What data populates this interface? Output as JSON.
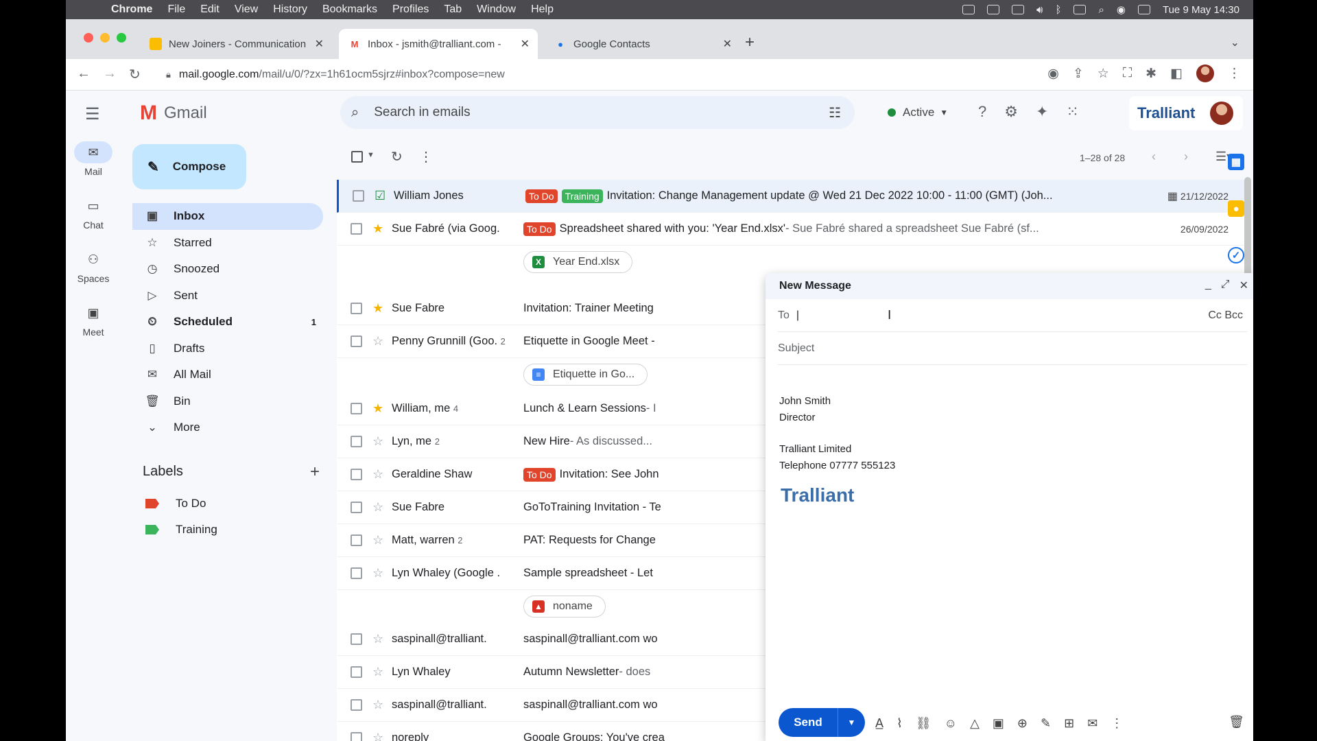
{
  "menubar": {
    "app": "Chrome",
    "items": [
      "File",
      "Edit",
      "View",
      "History",
      "Bookmarks",
      "Profiles",
      "Tab",
      "Window",
      "Help"
    ],
    "clock": "Tue 9 May  14:30"
  },
  "tabs": [
    {
      "title": "New Joiners - Communication",
      "icon": "calendar-icon"
    },
    {
      "title": "Inbox - jsmith@tralliant.com -",
      "icon": "gmail-icon"
    },
    {
      "title": "Google Contacts",
      "icon": "contacts-icon"
    }
  ],
  "url": {
    "host": "mail.google.com",
    "path": "/mail/u/0/?zx=1h61ocm5sjrz#inbox?compose=new"
  },
  "gmail": {
    "app_name": "Gmail",
    "search_placeholder": "Search in emails",
    "status": "Active",
    "brand": "Tralliant"
  },
  "rail": [
    {
      "label": "Mail",
      "icon": "mail-icon"
    },
    {
      "label": "Chat",
      "icon": "chat-icon"
    },
    {
      "label": "Spaces",
      "icon": "spaces-icon"
    },
    {
      "label": "Meet",
      "icon": "meet-icon"
    }
  ],
  "compose_button": "Compose",
  "nav": [
    {
      "label": "Inbox",
      "icon": "inbox-icon",
      "count": ""
    },
    {
      "label": "Starred",
      "icon": "star-icon",
      "count": ""
    },
    {
      "label": "Snoozed",
      "icon": "clock-icon",
      "count": ""
    },
    {
      "label": "Sent",
      "icon": "send-icon",
      "count": ""
    },
    {
      "label": "Scheduled",
      "icon": "scheduled-icon",
      "count": "1"
    },
    {
      "label": "Drafts",
      "icon": "draft-icon",
      "count": ""
    },
    {
      "label": "All Mail",
      "icon": "all-mail-icon",
      "count": ""
    },
    {
      "label": "Bin",
      "icon": "trash-icon",
      "count": ""
    },
    {
      "label": "More",
      "icon": "chevron-down-icon",
      "count": ""
    }
  ],
  "labels": {
    "heading": "Labels",
    "items": [
      {
        "label": "To Do",
        "color": "#e0452c"
      },
      {
        "label": "Training",
        "color": "#3cb45c"
      }
    ]
  },
  "list": {
    "count": "1–28 of 28",
    "rows": [
      {
        "sender": "William Jones",
        "n": "",
        "chips": [
          "To Do",
          "Training"
        ],
        "subject": "Invitation: Change Management update @ Wed 21 Dec 2022 10:00 - 11:00 (GMT) (Joh...",
        "snippet": "",
        "date": "21/12/2022",
        "starred": false
      },
      {
        "sender": "Sue Fabré (via Goog.",
        "n": "",
        "chips": [
          "To Do"
        ],
        "subject": "Spreadsheet shared with you: 'Year End.xlsx'",
        "snippet": " - Sue Fabré shared a spreadsheet Sue Fabré (sf...",
        "date": "26/09/2022",
        "starred": true,
        "attachment": "Year End.xlsx"
      },
      {
        "sender": "Sue Fabre",
        "n": "",
        "chips": [],
        "subject": "Invitation: Trainer Meeting",
        "snippet": "",
        "date": "",
        "starred": true
      },
      {
        "sender": "Penny Grunnill (Goo.",
        "n": "2",
        "chips": [],
        "subject": "Etiquette in Google Meet -",
        "snippet": "",
        "date": "",
        "starred": false,
        "attachment": "Etiquette in Go..."
      },
      {
        "sender": "William, me",
        "n": "4",
        "chips": [],
        "subject": "Lunch & Learn Sessions",
        "snippet": " - I",
        "date": "",
        "starred": true
      },
      {
        "sender": "Lyn, me",
        "n": "2",
        "chips": [],
        "subject": "New Hire",
        "snippet": " - As discussed...",
        "date": "",
        "starred": false
      },
      {
        "sender": "Geraldine Shaw",
        "n": "",
        "chips": [
          "To Do"
        ],
        "subject": "Invitation: See John",
        "snippet": "",
        "date": "",
        "starred": false
      },
      {
        "sender": "Sue Fabre",
        "n": "",
        "chips": [],
        "subject": "GoToTraining Invitation - Te",
        "snippet": "",
        "date": "",
        "starred": false
      },
      {
        "sender": "Matt, warren",
        "n": "2",
        "chips": [],
        "subject": "PAT: Requests for Change",
        "snippet": "",
        "date": "",
        "starred": false
      },
      {
        "sender": "Lyn Whaley (Google .",
        "n": "",
        "chips": [],
        "subject": "Sample spreadsheet - Let",
        "snippet": "",
        "date": "",
        "starred": false,
        "attachment": "noname"
      },
      {
        "sender": "saspinall@tralliant.",
        "n": "",
        "chips": [],
        "subject": "saspinall@tralliant.com wo",
        "snippet": "",
        "date": "",
        "starred": false
      },
      {
        "sender": "Lyn Whaley",
        "n": "",
        "chips": [],
        "subject": "Autumn Newsletter",
        "snippet": " - does",
        "date": "",
        "starred": false
      },
      {
        "sender": "saspinall@tralliant.",
        "n": "",
        "chips": [],
        "subject": "saspinall@tralliant.com wo",
        "snippet": "",
        "date": "",
        "starred": false
      },
      {
        "sender": "noreply",
        "n": "",
        "chips": [],
        "subject": "Google Groups: You've crea",
        "snippet": "",
        "date": "",
        "starred": false
      }
    ]
  },
  "compose": {
    "title": "New Message",
    "to_label": "To",
    "ccbcc": "Cc Bcc",
    "subject_placeholder": "Subject",
    "signature": [
      "John Smith",
      "Director",
      "Tralliant Limited",
      "Telephone 07777 555123"
    ],
    "signature_brand": "Tralliant",
    "send": "Send"
  }
}
